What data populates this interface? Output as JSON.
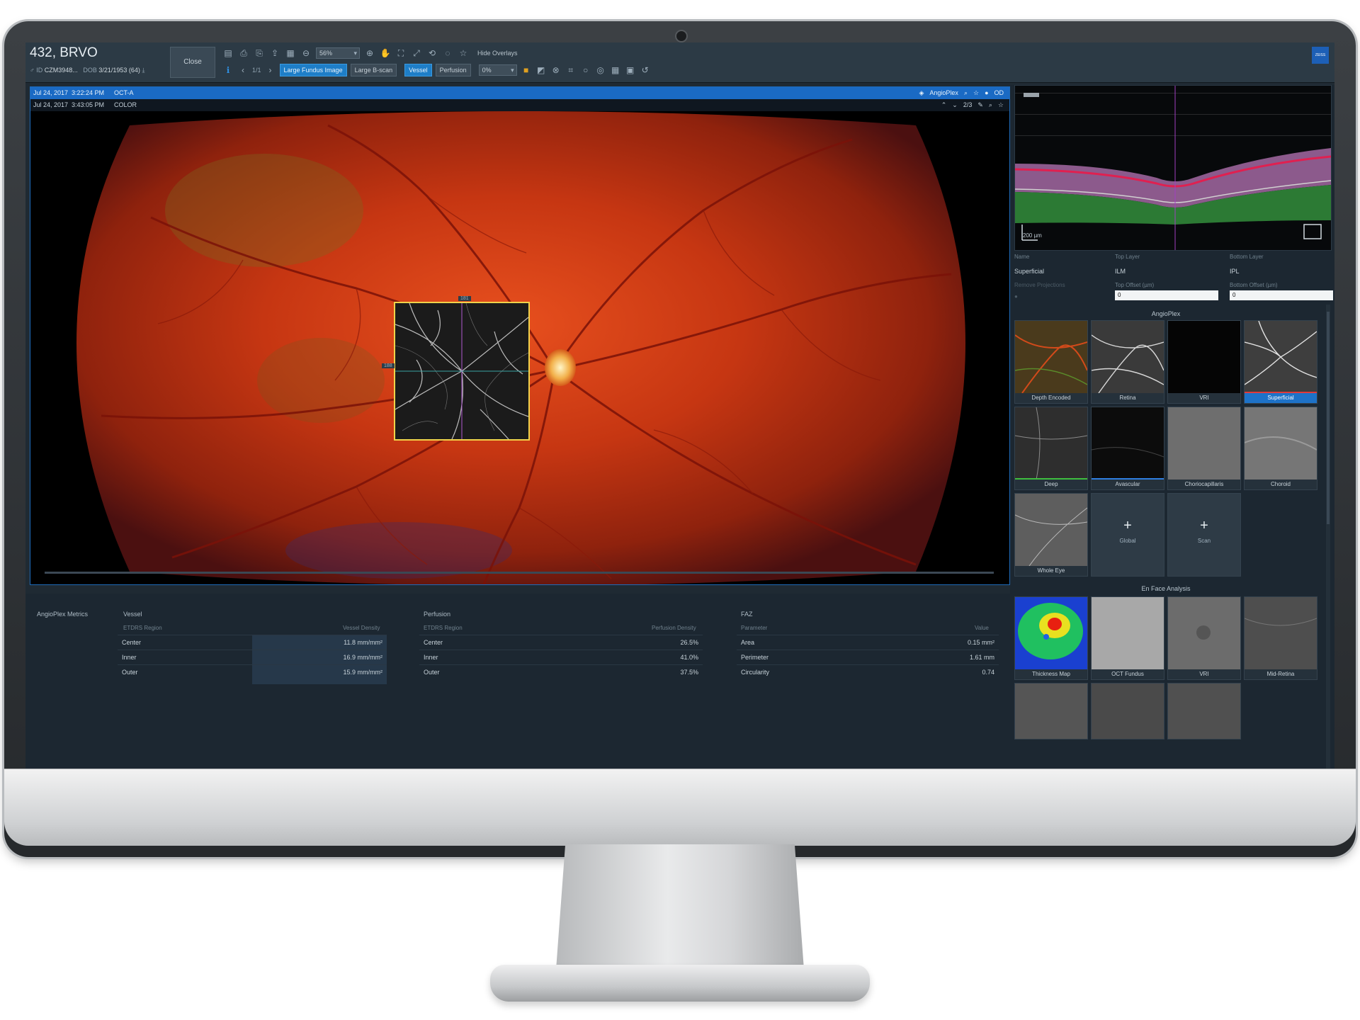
{
  "header": {
    "patient_name": "432, BRVO",
    "id_label": "ID",
    "id_value": "CZM3948...",
    "dob_label": "DOB",
    "dob_value": "3/21/1953",
    "age": "(64)",
    "close_label": "Close",
    "zoom_value": "56%",
    "hide_overlays_label": "Hide Overlays",
    "page_indicator": "1/1",
    "large_fundus_label": "Large Fundus Image",
    "large_bscan_label": "Large B-scan",
    "vessel_label": "Vessel",
    "perfusion_label": "Perfusion",
    "opacity_value": "0%",
    "brand": "ZEISS"
  },
  "viewer": {
    "octa_header": {
      "date": "Jul 24, 2017",
      "time": "3:22:24 PM",
      "modality": "OCT-A",
      "scan_type": "AngioPlex",
      "eye": "OD"
    },
    "color_header": {
      "date": "Jul 24, 2017",
      "time": "3:43:05 PM",
      "modality": "COLOR",
      "image_index": "2/3"
    },
    "inset_label_top": "181",
    "inset_label_left": "188"
  },
  "metrics": {
    "title": "AngioPlex Metrics",
    "vessel": {
      "title": "Vessel",
      "col_region": "ETDRS Region",
      "col_value": "Vessel Density",
      "rows": [
        {
          "region": "Center",
          "value": "11.8 mm/mm²"
        },
        {
          "region": "Inner",
          "value": "16.9 mm/mm²"
        },
        {
          "region": "Outer",
          "value": "15.9 mm/mm²"
        }
      ]
    },
    "perfusion": {
      "title": "Perfusion",
      "col_region": "ETDRS Region",
      "col_value": "Perfusion Density",
      "rows": [
        {
          "region": "Center",
          "value": "26.5%"
        },
        {
          "region": "Inner",
          "value": "41.0%"
        },
        {
          "region": "Outer",
          "value": "37.5%"
        }
      ]
    },
    "faz": {
      "title": "FAZ",
      "col_param": "Parameter",
      "col_value": "Value",
      "rows": [
        {
          "param": "Area",
          "value": "0.15 mm²"
        },
        {
          "param": "Perimeter",
          "value": "1.61 mm"
        },
        {
          "param": "Circularity",
          "value": "0.74"
        }
      ]
    }
  },
  "right_panel": {
    "oct_scale": "200 µm",
    "layer": {
      "name_label": "Name",
      "name_value": "Superficial",
      "top_layer_label": "Top Layer",
      "top_layer_value": "ILM",
      "bottom_layer_label": "Bottom Layer",
      "bottom_layer_value": "IPL",
      "remove_projections_label": "Remove Projections",
      "top_offset_label": "Top Offset (µm)",
      "top_offset_value": "0",
      "bottom_offset_label": "Bottom Offset (µm)",
      "bottom_offset_value": "0"
    },
    "angioplex_title": "AngioPlex",
    "angioplex_thumbs": [
      "Depth Encoded",
      "Retina",
      "VRI",
      "Superficial",
      "Deep",
      "Avascular",
      "Choriocapillaris",
      "Choroid",
      "Whole Eye"
    ],
    "add_global": "Global",
    "add_scan": "Scan",
    "enface_title": "En Face Analysis",
    "enface_thumbs": [
      "Thickness Map",
      "OCT Fundus",
      "VRI",
      "Mid-Retina"
    ]
  }
}
